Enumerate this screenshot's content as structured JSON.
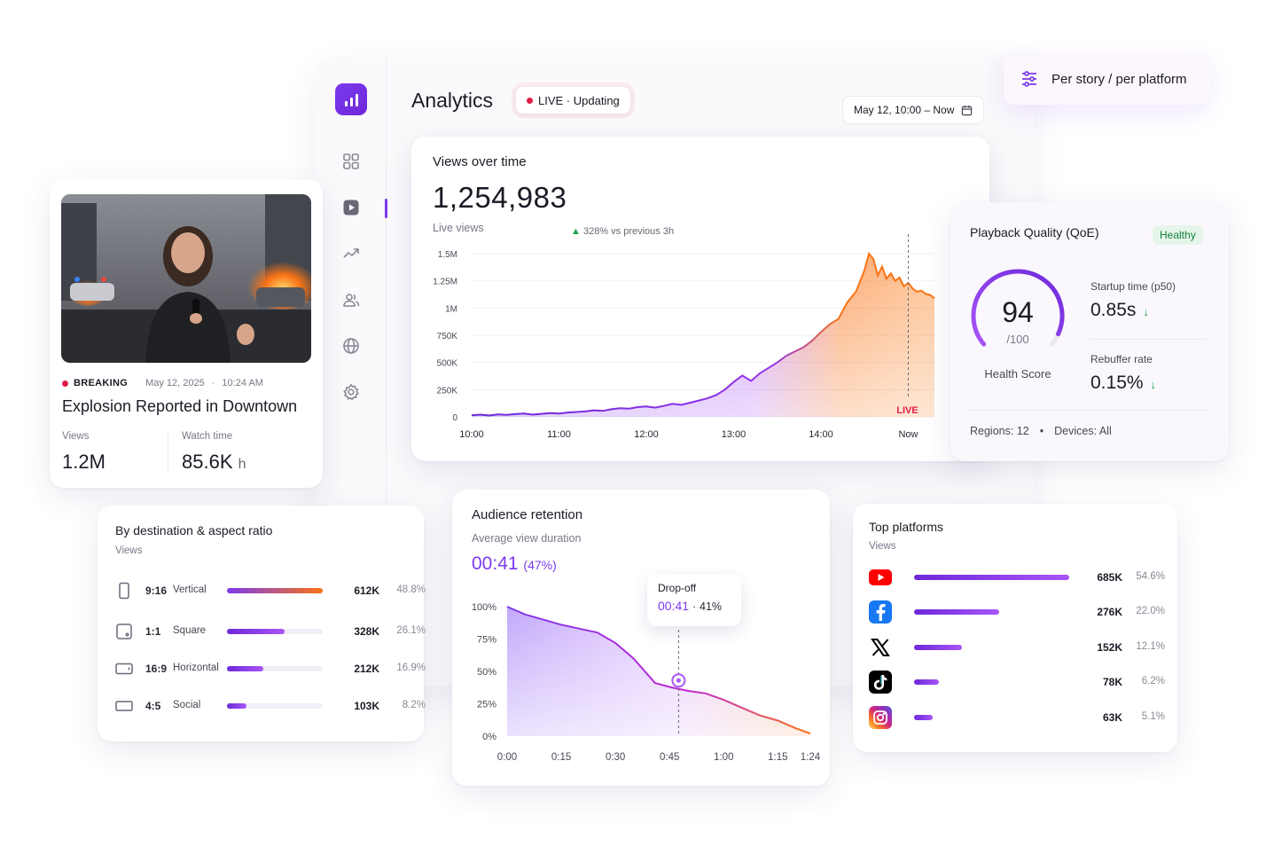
{
  "app": {
    "title": "Analytics",
    "live_label": "LIVE · Updating",
    "date_range": "May 12, 10:00 – Now"
  },
  "filter_chip": {
    "label": "Per story / per platform"
  },
  "story": {
    "tag": "BREAKING",
    "date": "May 12, 2025",
    "time": "10:24 AM",
    "headline": "Explosion Reported in Downtown",
    "views_label": "Views",
    "views_value": "1.2M",
    "watch_label": "Watch time",
    "watch_value": "85.6K",
    "watch_unit": "h"
  },
  "views_card": {
    "title": "Views over time",
    "total": "1,254,983",
    "subtitle": "Live views",
    "trend": "328% vs previous 3h",
    "live_marker": "LIVE"
  },
  "chart_data": [
    {
      "type": "area",
      "title": "Views over time",
      "y_ticks": [
        "1.5M",
        "1.25M",
        "1M",
        "750K",
        "500K",
        "250K",
        "0"
      ],
      "x_ticks": [
        "10:00",
        "11:00",
        "12:00",
        "13:00",
        "14:00",
        "Now"
      ],
      "ylim": [
        0,
        1500000
      ],
      "xlim": [
        0,
        5.3
      ],
      "x": [
        0,
        0.1,
        0.2,
        0.3,
        0.4,
        0.5,
        0.6,
        0.7,
        0.8,
        0.9,
        1.0,
        1.1,
        1.2,
        1.3,
        1.4,
        1.5,
        1.6,
        1.7,
        1.8,
        1.9,
        2.0,
        2.1,
        2.2,
        2.3,
        2.4,
        2.5,
        2.6,
        2.7,
        2.8,
        2.9,
        3.0,
        3.1,
        3.2,
        3.3,
        3.4,
        3.5,
        3.6,
        3.7,
        3.8,
        3.9,
        4.0,
        4.1,
        4.2,
        4.3,
        4.4,
        4.45,
        4.5,
        4.55,
        4.6,
        4.65,
        4.7,
        4.75,
        4.8,
        4.85,
        4.9,
        4.95,
        5.0,
        5.05,
        5.1,
        5.15,
        5.2,
        5.25,
        5.3
      ],
      "y": [
        15000,
        20000,
        12000,
        22000,
        18000,
        25000,
        30000,
        20000,
        28000,
        35000,
        30000,
        40000,
        45000,
        50000,
        60000,
        55000,
        70000,
        80000,
        75000,
        90000,
        95000,
        85000,
        100000,
        120000,
        110000,
        130000,
        150000,
        170000,
        200000,
        250000,
        320000,
        380000,
        330000,
        400000,
        450000,
        500000,
        560000,
        600000,
        640000,
        700000,
        780000,
        850000,
        900000,
        1050000,
        1150000,
        1250000,
        1350000,
        1500000,
        1450000,
        1300000,
        1380000,
        1270000,
        1320000,
        1250000,
        1280000,
        1200000,
        1230000,
        1180000,
        1150000,
        1160000,
        1130000,
        1120000,
        1090000
      ]
    },
    {
      "type": "area",
      "title": "Audience retention",
      "y_ticks": [
        "100%",
        "75%",
        "50%",
        "25%",
        "0%"
      ],
      "x_ticks": [
        "0:00",
        "0:15",
        "0:30",
        "0:45",
        "1:00",
        "1:15",
        "1:24"
      ],
      "ylim": [
        0,
        100
      ],
      "x_seconds": [
        0,
        5,
        10,
        15,
        20,
        25,
        30,
        35,
        41,
        45,
        50,
        55,
        60,
        65,
        70,
        75,
        80,
        84
      ],
      "y_percent": [
        100,
        94,
        90,
        86,
        83,
        80,
        72,
        60,
        41,
        38,
        35,
        33,
        28,
        22,
        16,
        12,
        6,
        2
      ]
    }
  ],
  "qoe": {
    "title": "Playback Quality (QoE)",
    "status": "Healthy",
    "score": "94",
    "score_out_of": "/100",
    "score_label": "Health Score",
    "score_fraction": 0.94,
    "startup_label": "Startup time (p50)",
    "startup_value": "0.85s",
    "rebuffer_label": "Rebuffer rate",
    "rebuffer_value": "0.15%",
    "regions": "Regions: 12",
    "devices": "Devices: All"
  },
  "destination": {
    "title": "By destination & aspect ratio",
    "subtitle": "Views",
    "rows": [
      {
        "ratio": "9:16",
        "name": "Vertical",
        "value": "612K",
        "pct": "48.8%",
        "share": 1.0,
        "icon": "phone-icon"
      },
      {
        "ratio": "1:1",
        "name": "Square",
        "value": "328K",
        "pct": "26.1%",
        "share": 0.6,
        "icon": "square-icon"
      },
      {
        "ratio": "16:9",
        "name": "Horizontal",
        "value": "212K",
        "pct": "16.9%",
        "share": 0.38,
        "icon": "tablet-icon"
      },
      {
        "ratio": "4:5",
        "name": "Social",
        "value": "103K",
        "pct": "8.2%",
        "share": 0.2,
        "icon": "rectangle-icon"
      }
    ]
  },
  "retention": {
    "title": "Audience retention",
    "subtitle": "Average view duration",
    "duration": "00:41",
    "duration_pct": "(47%)",
    "tooltip_title": "Drop-off",
    "tooltip_time": "00:41",
    "tooltip_pct": "41%"
  },
  "platforms": {
    "title": "Top platforms",
    "subtitle": "Views",
    "rows": [
      {
        "icon": "youtube-icon",
        "value": "685K",
        "pct": "54.6%",
        "share": 1.0,
        "color": "#ff0000"
      },
      {
        "icon": "facebook-icon",
        "value": "276K",
        "pct": "22.0%",
        "share": 0.55,
        "color": "#1877f2"
      },
      {
        "icon": "x-icon",
        "value": "152K",
        "pct": "12.1%",
        "share": 0.31,
        "color": "#000000"
      },
      {
        "icon": "tiktok-icon",
        "value": "78K",
        "pct": "6.2%",
        "share": 0.16,
        "color": "#000000"
      },
      {
        "icon": "instagram-icon",
        "value": "63K",
        "pct": "5.1%",
        "share": 0.12,
        "color": "#d62976"
      }
    ]
  },
  "colors": {
    "accent": "#7c3aed",
    "orange": "#f97316",
    "live_red": "#e11d48",
    "healthy_green": "#16a34a"
  }
}
